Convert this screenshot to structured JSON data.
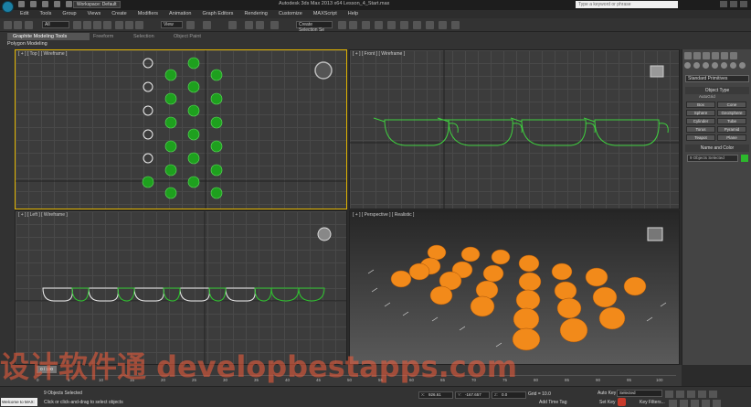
{
  "window": {
    "title": "Autodesk 3ds Max  2013 x64     Lesson_4_Start.max",
    "workspace": "Workspace: Default",
    "search_placeholder": "Type a keyword or phrase"
  },
  "menu": [
    "Edit",
    "Tools",
    "Group",
    "Views",
    "Create",
    "Modifiers",
    "Animation",
    "Graph Editors",
    "Rendering",
    "Customize",
    "MAXScript",
    "Help"
  ],
  "toolbar": {
    "filter": "All",
    "ref_coord": "View",
    "selection_set": "Create Selection Se"
  },
  "ribbon": {
    "tabs": [
      "Graphite Modeling Tools",
      "Freeform",
      "Selection",
      "Object Paint"
    ],
    "panel": "Polygon Modeling"
  },
  "viewports": {
    "top": "[ + ] [ Top ] [ Wireframe ]",
    "front": "[ + ] [ Front ] [ Wireframe ]",
    "left": "[ + ] [ Left ] [ Wireframe ]",
    "persp": "[ + ] [ Perspective ] [ Realistic ]"
  },
  "cmd": {
    "dropdown": "Standard Primitives",
    "rollout_type": "Object Type",
    "autogrid": "AutoGrid",
    "buttons": [
      "Box",
      "Cone",
      "Sphere",
      "GeoSphere",
      "Cylinder",
      "Tube",
      "Torus",
      "Pyramid",
      "Teapot",
      "Plane"
    ],
    "rollout_name": "Name and Color",
    "name_value": "9 Objects Selected",
    "color": "#2cb82c"
  },
  "timeline": {
    "slider": "0 / 100",
    "ticks": [
      "0",
      "5",
      "10",
      "15",
      "20",
      "25",
      "30",
      "35",
      "40",
      "45",
      "50",
      "55",
      "60",
      "65",
      "70",
      "75",
      "80",
      "85",
      "90",
      "95",
      "100"
    ]
  },
  "status": {
    "maxscript": "Welcome to MAX:",
    "selected": "9 Objects Selected",
    "prompt": "Click or click-and-drag to select objects",
    "x": "926.61",
    "y": "-167.657",
    "z": "0.0",
    "grid": "Grid = 10.0",
    "add_tag": "Add Time Tag",
    "autokey": "Auto Key",
    "setkey": "Set Key",
    "selected_dd": "Selected",
    "key_filters": "Key Filters..."
  },
  "watermark": "设计软件通 developbestapps.com"
}
